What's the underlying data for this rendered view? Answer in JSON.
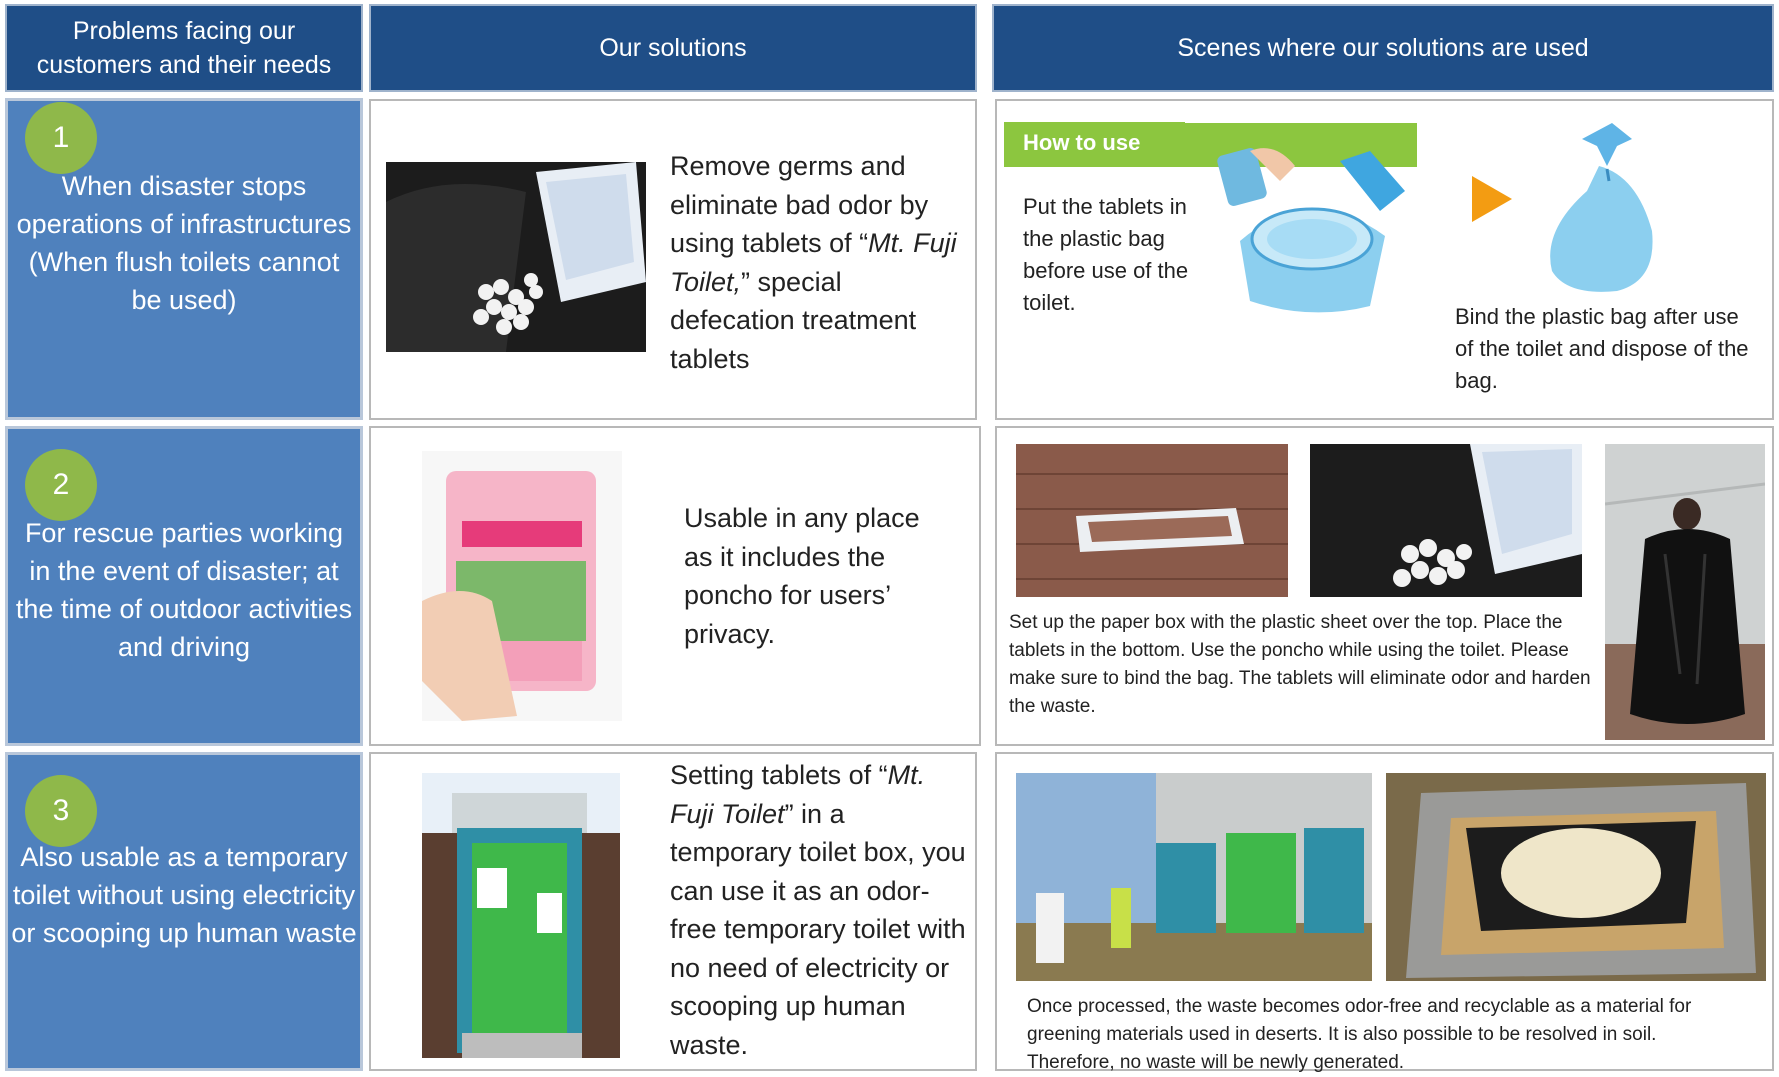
{
  "headers": {
    "problems": "Problems facing our customers and their needs",
    "solutions": "Our solutions",
    "scenes": "Scenes where our solutions are used"
  },
  "rows": [
    {
      "number": "1",
      "problem": "When disaster stops operations of infrastructures (When flush toilets cannot be used)",
      "solution_pre": "Remove germs and eliminate bad odor by using tablets of “",
      "solution_italic": "Mt. Fuji Toilet,",
      "solution_post": "” special defecation treatment tablets",
      "how_to_use_label": "How to use",
      "step1": "Put the tablets in the plastic bag before use of the toilet.",
      "step2": "Bind the plastic bag after use of the toilet and dispose of the bag."
    },
    {
      "number": "2",
      "problem": "For rescue parties working in the event of disaster; at the time of outdoor activities and driving",
      "solution": "Usable in any place as it includes the poncho for users’ privacy.",
      "scene_text": "Set up the paper box with the plastic sheet over the top. Place the tablets in the bottom. Use the poncho while using the toilet. Please make sure to bind the bag. The tablets will eliminate odor and harden the waste."
    },
    {
      "number": "3",
      "problem": "Also usable as a temporary toilet without using electricity or scooping up human waste",
      "solution_pre": "Setting tablets of “",
      "solution_italic": "Mt. Fuji Toilet",
      "solution_post": "” in a temporary toilet box, you can use it as an odor-free temporary toilet with no need of electricity or scooping up human waste.",
      "scene_text": "Once processed, the waste becomes odor-free and recyclable as a material for greening materials used in deserts. It is also possible to be resolved in soil. Therefore, no waste will be newly generated."
    }
  ],
  "colors": {
    "header_bg": "#1f4e87",
    "problem_bg": "#4f81bd",
    "number_circle": "#8fb84a",
    "how_to_use_bg": "#8cc63f",
    "arrow": "#f39c12"
  }
}
